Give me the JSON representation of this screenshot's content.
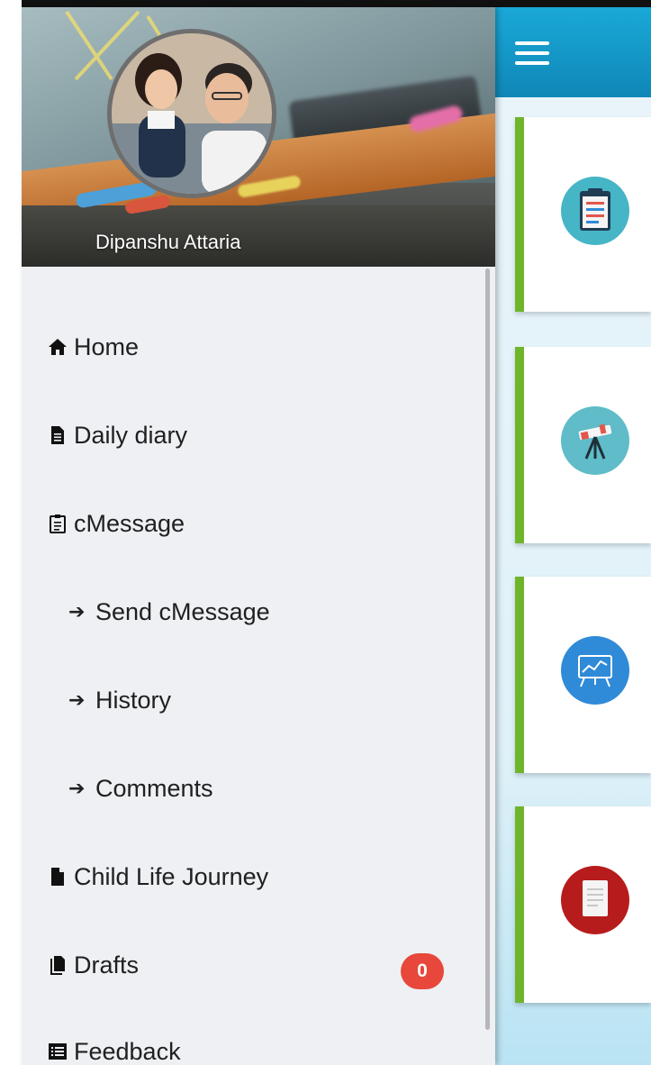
{
  "app": {
    "menu_icon": "hamburger-icon",
    "accent_color": "#1aa9d8",
    "card_accent_color": "#6fb52c"
  },
  "drawer": {
    "user_name": "Dipanshu Attaria",
    "items": [
      {
        "label": "Home",
        "icon": "home-icon"
      },
      {
        "label": "Daily diary",
        "icon": "document-icon"
      },
      {
        "label": "cMessage",
        "icon": "clipboard-icon"
      },
      {
        "label": "Send cMessage",
        "icon": "arrow-right-icon"
      },
      {
        "label": "History",
        "icon": "arrow-right-icon"
      },
      {
        "label": "Comments",
        "icon": "arrow-right-icon"
      },
      {
        "label": "Child Life Journey",
        "icon": "file-icon"
      },
      {
        "label": "Drafts",
        "icon": "files-icon",
        "badge": "0"
      },
      {
        "label": "Feedback",
        "icon": "list-icon"
      }
    ]
  },
  "cards": [
    {
      "icon": "clipboard-icon",
      "color": "#46b5c6"
    },
    {
      "icon": "telescope-icon",
      "color": "#46b5c6"
    },
    {
      "icon": "presentation-board-icon",
      "color": "#2f8ad8"
    },
    {
      "icon": "report-document-icon",
      "color": "#b71c1c"
    }
  ]
}
